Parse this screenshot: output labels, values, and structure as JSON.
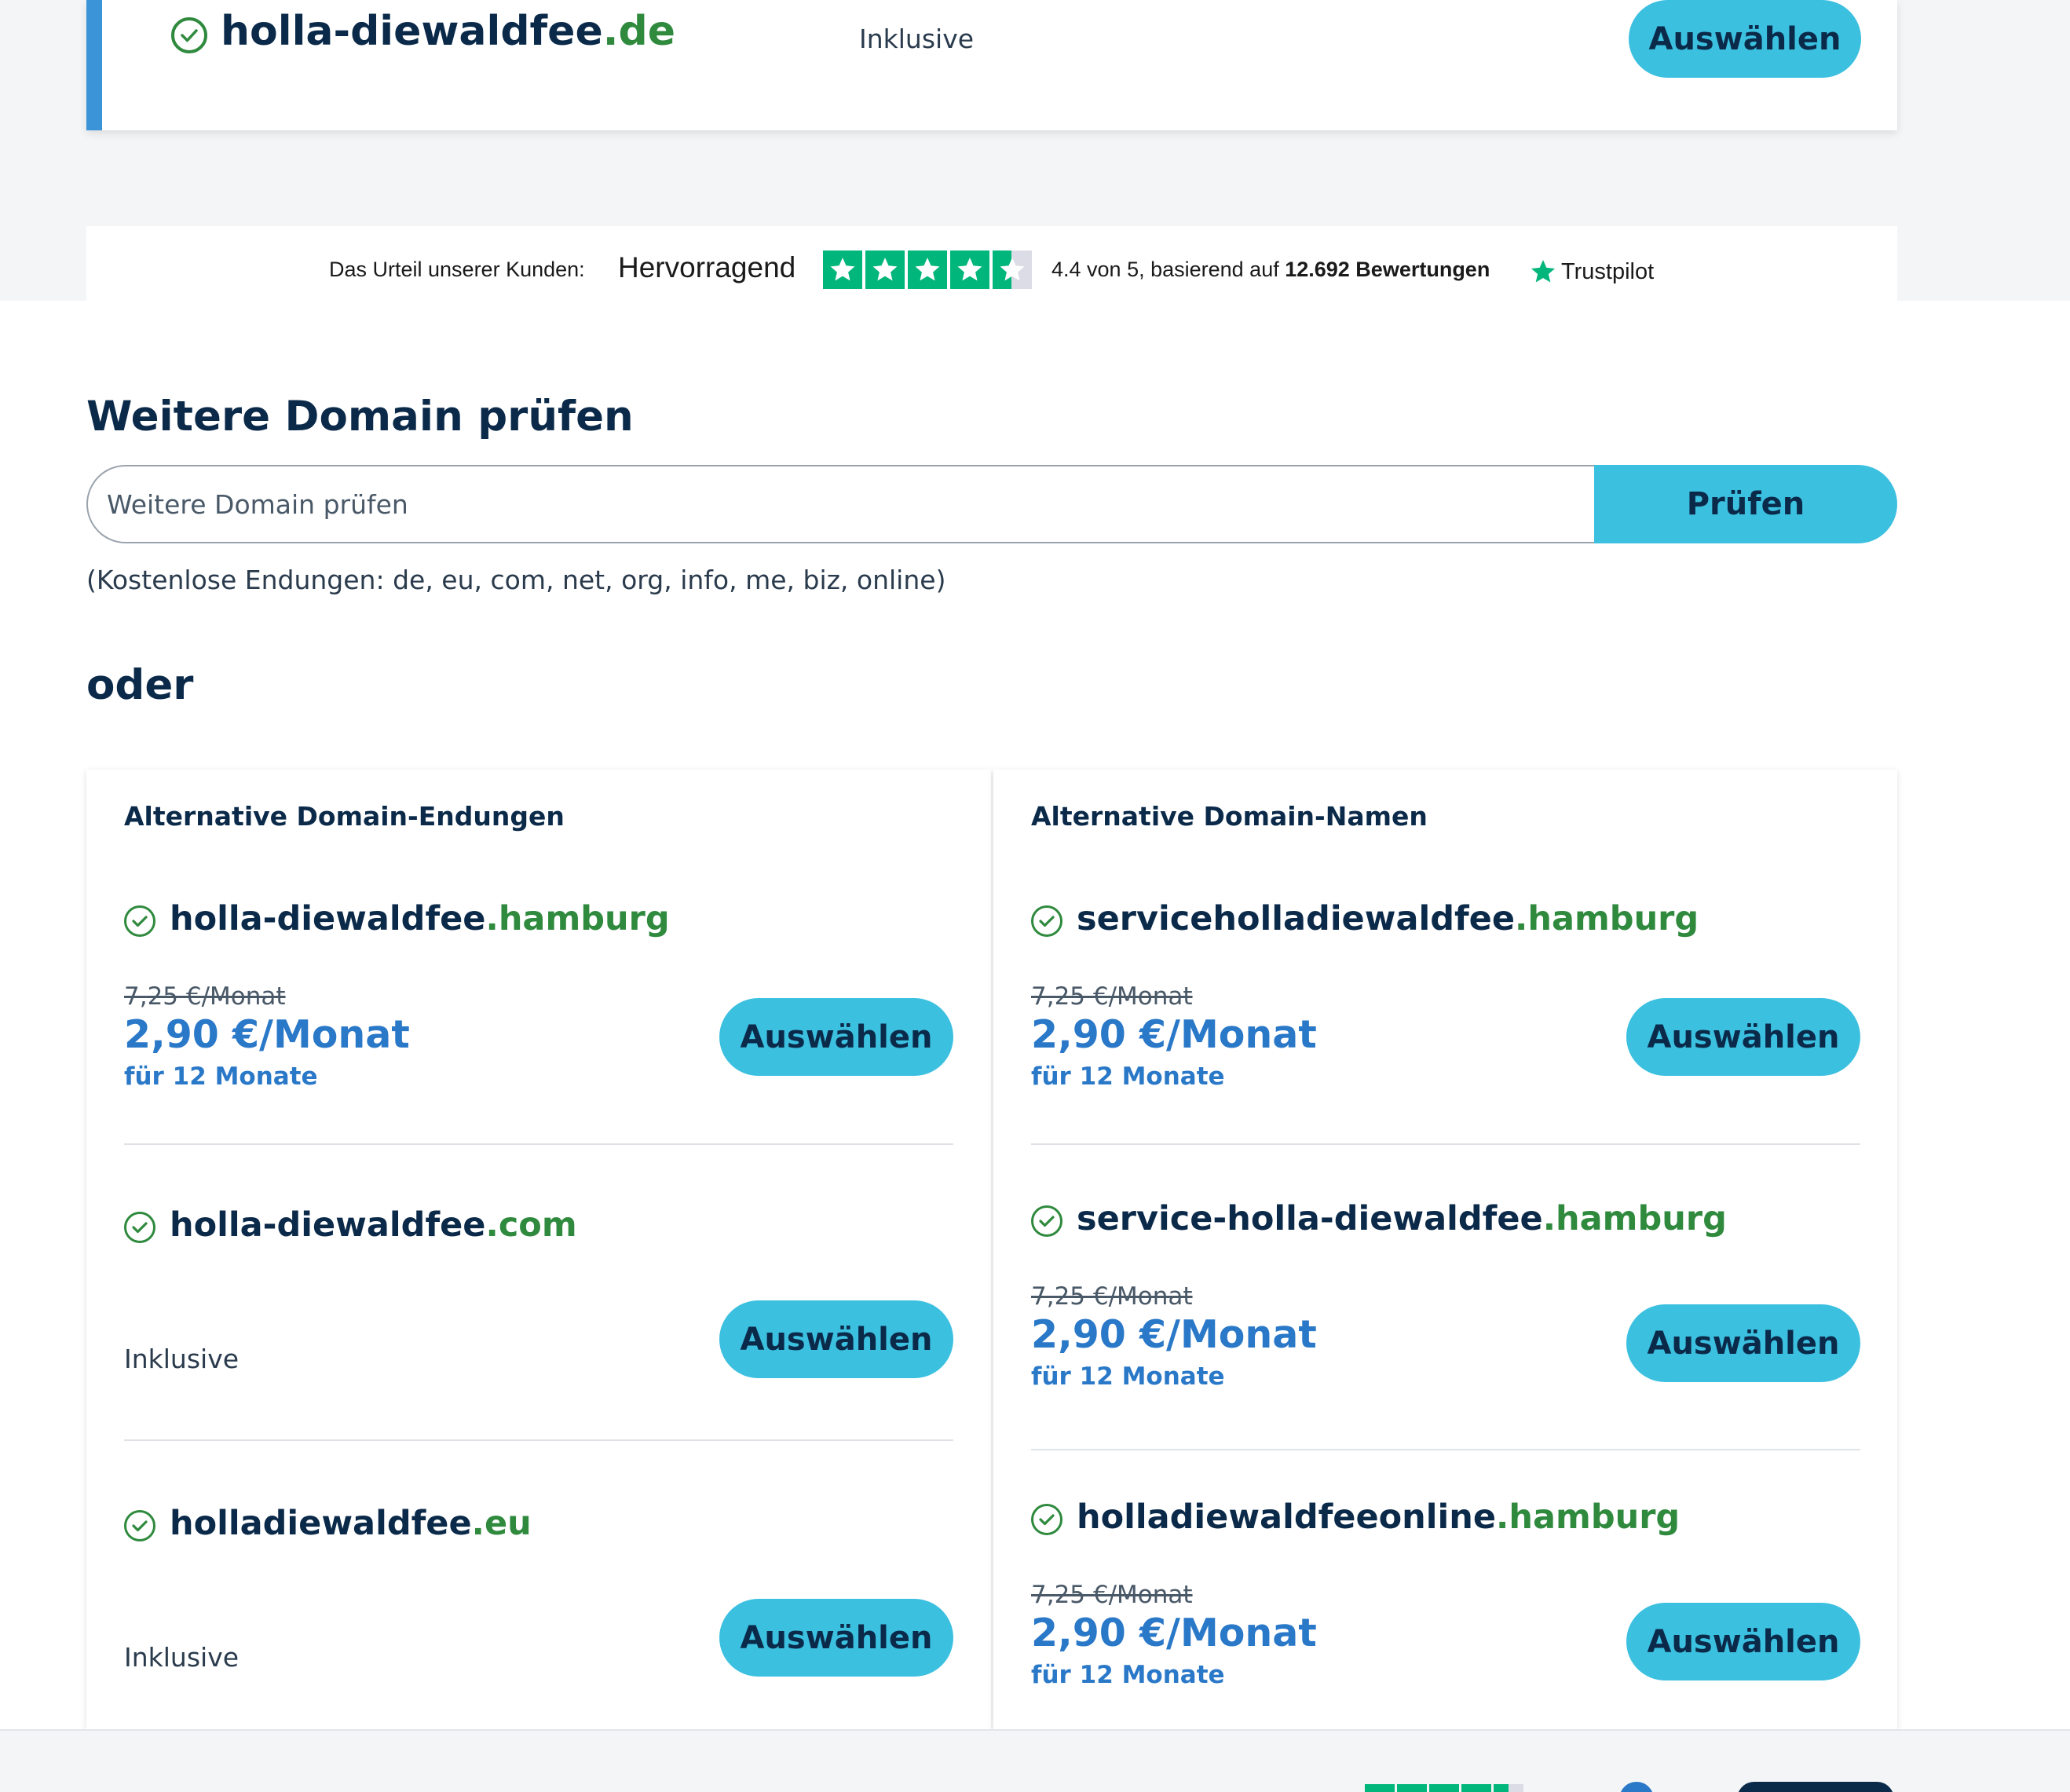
{
  "selected": {
    "name": "holla-diewaldfee",
    "tld": ".de",
    "status": "Inklusive",
    "button": "Auswählen"
  },
  "trustpilot": {
    "intro": "Das Urteil unserer Kunden:",
    "verdict": "Hervorragend",
    "score_prefix": "4.4 von 5, basierend auf ",
    "count": "12.692 Bewertungen",
    "brand": "Trustpilot",
    "rating": 4.4,
    "color": "#00b67a"
  },
  "search": {
    "heading": "Weitere Domain prüfen",
    "placeholder": "Weitere Domain prüfen",
    "button": "Prüfen",
    "hint": "(Kostenlose Endungen: de, eu, com, net, org, info, me, biz, online)"
  },
  "oder": "oder",
  "alt_endings": {
    "title": "Alternative Domain-Endungen",
    "items": [
      {
        "name": "holla-diewaldfee",
        "tld": ".hamburg",
        "old_price": "7,25 €/Monat",
        "price": "2,90 €/Monat",
        "term": "für 12 Monate",
        "button": "Auswählen"
      },
      {
        "name": "holla-diewaldfee",
        "tld": ".com",
        "status": "Inklusive",
        "button": "Auswählen"
      },
      {
        "name": "holladiewaldfee",
        "tld": ".eu",
        "status": "Inklusive",
        "button": "Auswählen"
      }
    ]
  },
  "alt_names": {
    "title": "Alternative Domain-Namen",
    "items": [
      {
        "name": "serviceholladiewaldfee",
        "tld": ".hamburg",
        "old_price": "7,25 €/Monat",
        "price": "2,90 €/Monat",
        "term": "für 12 Monate",
        "button": "Auswählen"
      },
      {
        "name": "service-holla-diewaldfee",
        "tld": ".hamburg",
        "old_price": "7,25 €/Monat",
        "price": "2,90 €/Monat",
        "term": "für 12 Monate",
        "button": "Auswählen"
      },
      {
        "name": "holladiewaldfeeonline",
        "tld": ".hamburg",
        "old_price": "7,25 €/Monat",
        "price": "2,90 €/Monat",
        "term": "für 12 Monate",
        "button": "Auswählen"
      }
    ]
  },
  "colors": {
    "accent": "#3cc0e0",
    "brand_dark": "#0b2a4a",
    "tld_green": "#2f8a3e",
    "price_blue": "#2a78c8"
  }
}
